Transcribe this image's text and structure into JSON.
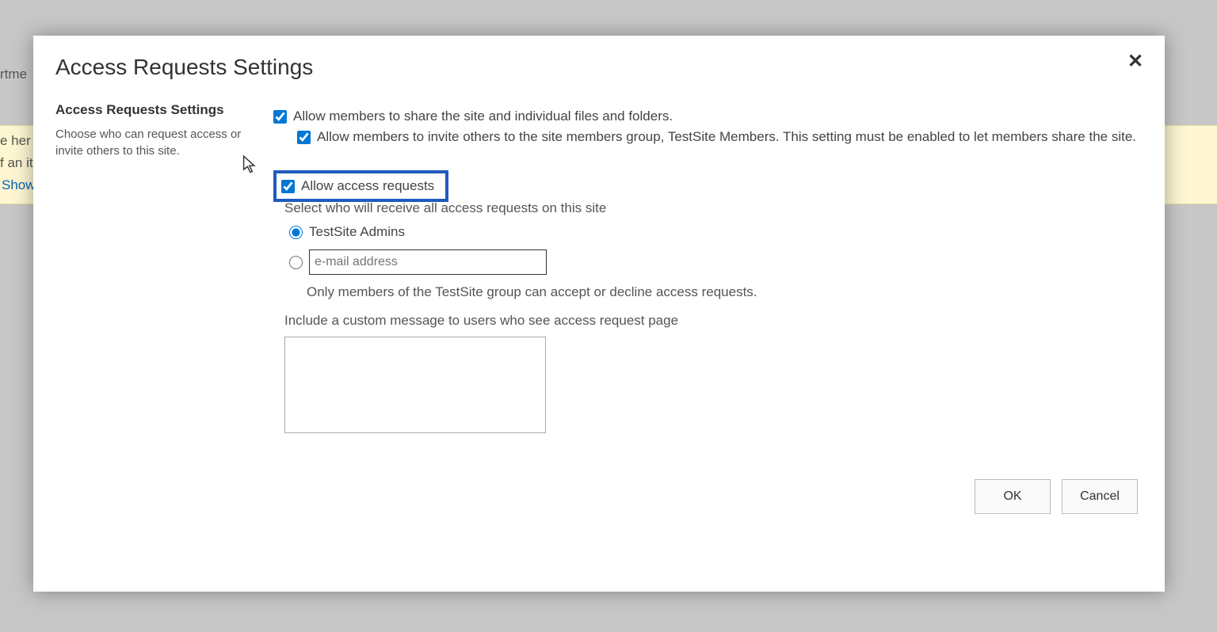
{
  "background": {
    "link1_fragment": "rtme",
    "hint_line1_fragment": "e her",
    "hint_line2_fragment": "f an it",
    "show_fragment": "Show"
  },
  "modal": {
    "title": "Access Requests Settings",
    "section_heading": "Access Requests Settings",
    "section_desc": "Choose who can request access or invite others to this site.",
    "checkbox_share_label": "Allow members to share the site and individual files and folders.",
    "checkbox_share_checked": true,
    "checkbox_invite_label": "Allow members to invite others to the site members group, TestSite Members. This setting must be enabled to let members share the site.",
    "checkbox_invite_checked": true,
    "checkbox_allow_requests_label": "Allow access requests",
    "checkbox_allow_requests_checked": true,
    "receive_label": "Select who will receive all access requests on this site",
    "radio_admins_label": "TestSite Admins",
    "radio_admins_selected": true,
    "radio_email_selected": false,
    "email_placeholder": "e-mail address",
    "email_value": "",
    "accept_hint": "Only members of the TestSite group can accept or decline access requests.",
    "custom_msg_label": "Include a custom message to users who see access request page",
    "custom_msg_value": "",
    "btn_ok": "OK",
    "btn_cancel": "Cancel"
  }
}
